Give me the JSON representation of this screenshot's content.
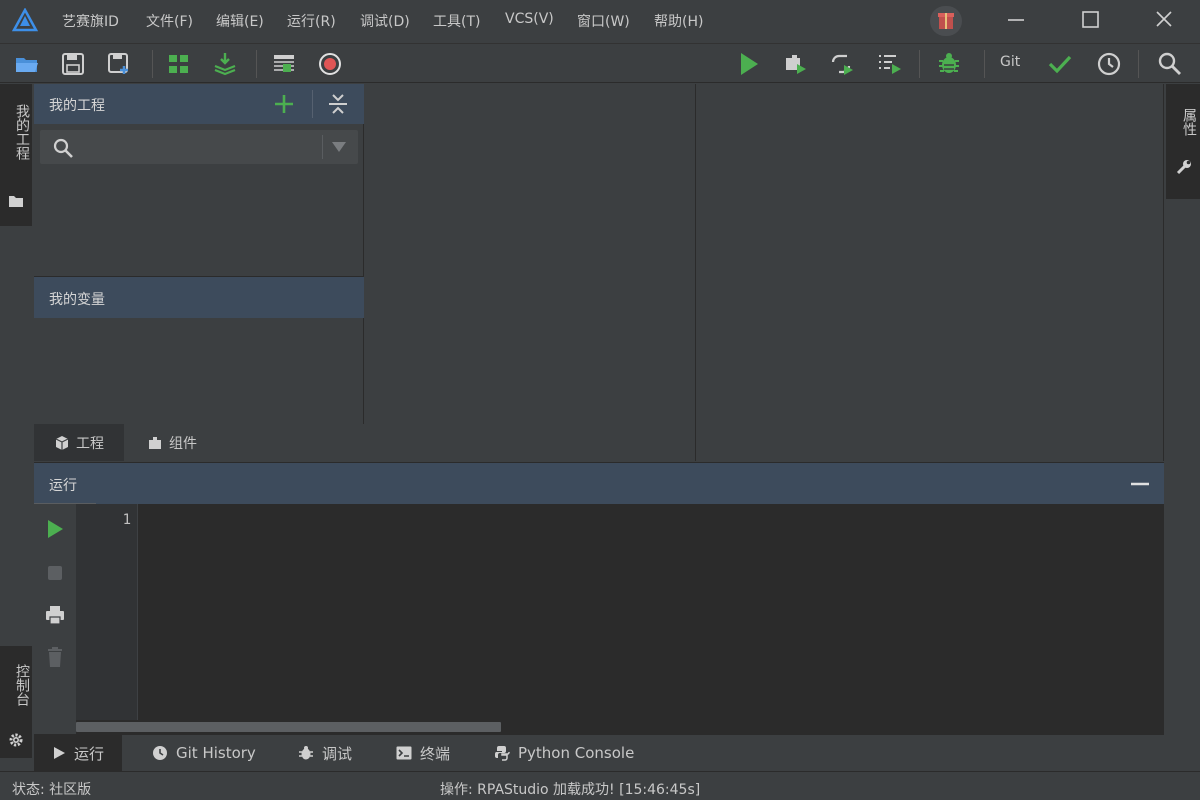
{
  "app": {
    "title": "艺赛旗ID"
  },
  "menu": [
    "文件(F)",
    "编辑(E)",
    "运行(R)",
    "调试(D)",
    "工具(T)",
    "VCS(V)",
    "窗口(W)",
    "帮助(H)"
  ],
  "toolbar": {
    "git_label": "Git"
  },
  "left_strip": {
    "project_label": "我的工程",
    "console_label": "控制台"
  },
  "right_strip": {
    "properties_label": "属性"
  },
  "project_panel": {
    "title": "我的工程",
    "search": {
      "value": "",
      "placeholder": ""
    },
    "variables_title": "我的变量",
    "tabs": [
      "工程",
      "组件"
    ]
  },
  "run_panel": {
    "title": "运行",
    "line_numbers": [
      "1"
    ]
  },
  "bottom_tabs": [
    "运行",
    "Git History",
    "调试",
    "终端",
    "Python Console"
  ],
  "status": {
    "left": "状态: 社区版",
    "right": "操作: RPAStudio 加载成功! [15:46:45s]"
  },
  "colors": {
    "accent_green": "#4caf50",
    "record_red": "#e05555",
    "header_blue": "#3d4b5c",
    "logo_blue": "#3d8fe8"
  }
}
